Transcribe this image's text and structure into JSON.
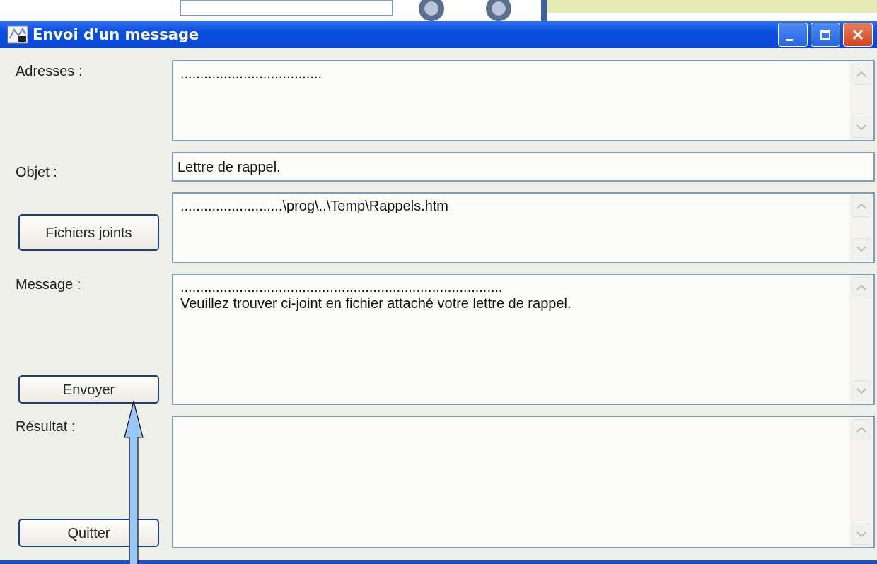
{
  "window": {
    "title": "Envoi d'un message"
  },
  "rows": [
    {
      "label": "Adresses :",
      "field": {
        "kind": "textarea",
        "lines": [
          "...................................."
        ]
      }
    },
    {
      "label": "Objet :",
      "field": {
        "kind": "input",
        "value": "Lettre de rappel."
      }
    },
    {
      "button": "Fichiers joints",
      "field": {
        "kind": "textarea",
        "lines": [
          "..........................\\prog\\..\\Temp\\Rappels.htm"
        ]
      }
    },
    {
      "label": "Message :",
      "button": "Envoyer",
      "field": {
        "kind": "textarea",
        "lines": [
          "..................................................................................",
          "Veuillez trouver ci-joint en fichier attaché votre lettre de rappel."
        ]
      }
    },
    {
      "label": "Résultat :",
      "button": "Quitter",
      "field": {
        "kind": "textarea"
      }
    }
  ]
}
